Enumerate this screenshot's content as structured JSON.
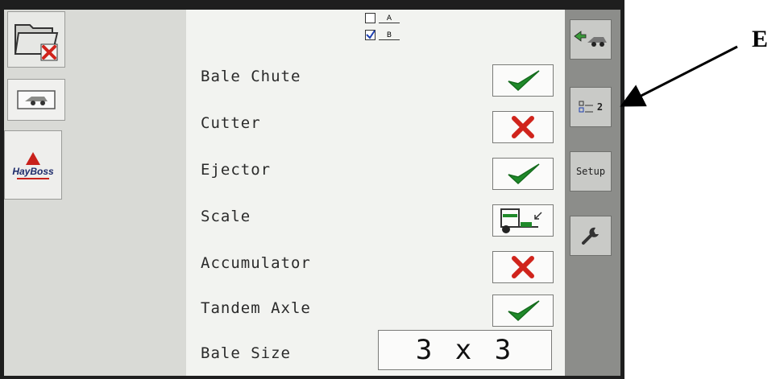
{
  "brand": {
    "logo_text": "HayBoss"
  },
  "profiles": {
    "a": "A",
    "b": "B"
  },
  "options": [
    {
      "label": "Bale Chute",
      "status": "enabled",
      "icon": "check-icon"
    },
    {
      "label": "Cutter",
      "status": "disabled",
      "icon": "x-icon"
    },
    {
      "label": "Ejector",
      "status": "enabled",
      "icon": "check-icon"
    },
    {
      "label": "Scale",
      "status": "scale",
      "icon": "scale-icon"
    },
    {
      "label": "Accumulator",
      "status": "disabled",
      "icon": "x-icon"
    },
    {
      "label": "Tandem Axle",
      "status": "enabled",
      "icon": "check-icon"
    }
  ],
  "bale_size": {
    "label": "Bale Size",
    "value": "3 x 3"
  },
  "right_bar": {
    "profile_count": "2",
    "setup_label": "Setup"
  },
  "annotation": {
    "label": "E"
  },
  "colors": {
    "check": "#1f8a2a",
    "cross": "#d0241c",
    "right_bar": "#8c8d8a",
    "left_pane": "#d9dad6"
  }
}
